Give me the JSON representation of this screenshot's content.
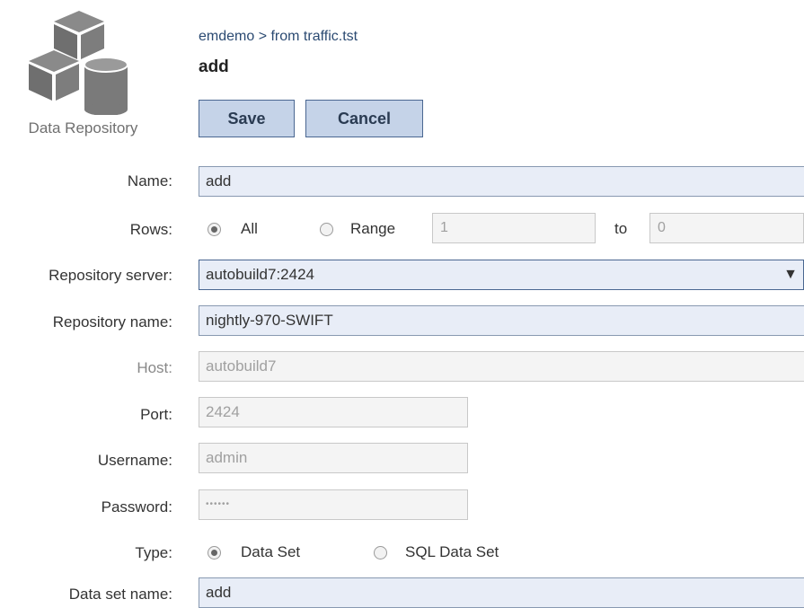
{
  "header": {
    "icon_caption": "Data Repository",
    "breadcrumb": "emdemo > from traffic.tst",
    "title": "add"
  },
  "toolbar": {
    "save_label": "Save",
    "cancel_label": "Cancel"
  },
  "form": {
    "name": {
      "label": "Name:",
      "value": "add"
    },
    "rows": {
      "label": "Rows:",
      "options": [
        "All",
        "Range"
      ],
      "selected": "All",
      "range_from": "1",
      "to_label": "to",
      "range_to": "0"
    },
    "repository_server": {
      "label": "Repository server:",
      "value": "autobuild7:2424"
    },
    "repository_name": {
      "label": "Repository name:",
      "value": "nightly-970-SWIFT"
    },
    "host": {
      "label": "Host:",
      "value": "autobuild7"
    },
    "port": {
      "label": "Port:",
      "value": "2424"
    },
    "username": {
      "label": "Username:",
      "value": "admin"
    },
    "password": {
      "label": "Password:",
      "value": "••••••"
    },
    "type": {
      "label": "Type:",
      "options": [
        "Data Set",
        "SQL Data Set"
      ],
      "selected": "Data Set"
    },
    "data_set_name": {
      "label": "Data set name:",
      "value": "add"
    }
  },
  "colors": {
    "accent_button_bg": "#c5d3e8",
    "accent_border": "#4a6791",
    "field_bg": "#e8edf7",
    "breadcrumb": "#2b4a72"
  },
  "icons": {
    "repository": "repository-cubes-database-icon",
    "dropdown": "triangle-down-icon"
  }
}
